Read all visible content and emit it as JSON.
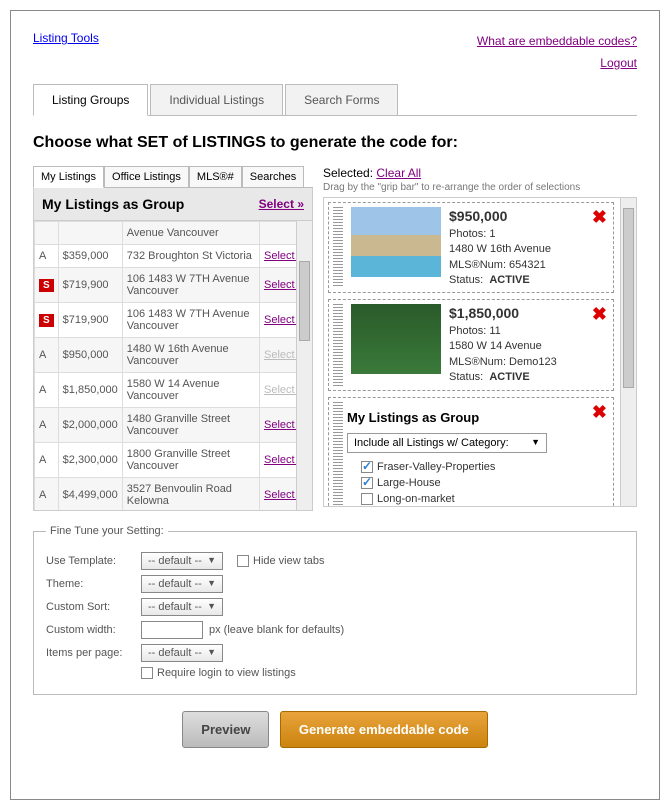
{
  "top": {
    "listing_tools": "Listing Tools",
    "what_are": "What are embeddable codes?",
    "logout": "Logout"
  },
  "main_tabs": [
    "Listing Groups",
    "Individual Listings",
    "Search Forms"
  ],
  "heading": "Choose what SET of LISTINGS to generate the code for:",
  "sub_tabs": [
    "My Listings",
    "Office Listings",
    "MLS®#",
    "Searches"
  ],
  "group_title": "My Listings as Group",
  "select_all": "Select »",
  "listings": [
    {
      "st": "",
      "price": "",
      "addr": "Avenue Vancouver",
      "sel": "",
      "muted": false
    },
    {
      "st": "A",
      "price": "$359,000",
      "addr": "732 Broughton St Victoria",
      "sel": "Select »",
      "muted": false
    },
    {
      "st": "S",
      "price": "$719,900",
      "addr": "106 1483 W 7TH Avenue Vancouver",
      "sel": "Select »",
      "muted": false,
      "badge": true
    },
    {
      "st": "S",
      "price": "$719,900",
      "addr": "106 1483 W 7TH Avenue Vancouver",
      "sel": "Select »",
      "muted": false,
      "badge": true
    },
    {
      "st": "A",
      "price": "$950,000",
      "addr": "1480 W 16th Avenue Vancouver",
      "sel": "Select »",
      "muted": true
    },
    {
      "st": "A",
      "price": "$1,850,000",
      "addr": "1580 W 14 Avenue Vancouver",
      "sel": "Select »",
      "muted": true
    },
    {
      "st": "A",
      "price": "$2,000,000",
      "addr": "1480 Granville Street Vancouver",
      "sel": "Select »",
      "muted": false
    },
    {
      "st": "A",
      "price": "$2,300,000",
      "addr": "1800 Granville Street Vancouver",
      "sel": "Select »",
      "muted": false
    },
    {
      "st": "A",
      "price": "$4,499,000",
      "addr": "3527 Benvoulin Road Kelowna",
      "sel": "Select »",
      "muted": false
    }
  ],
  "selected_label": "Selected:",
  "clear_all": "Clear All",
  "drag_hint": "Drag by the \"grip bar\" to re-arrange the order of selections",
  "cards": [
    {
      "price": "$950,000",
      "photos": "Photos: 1",
      "addr": "1480 W 16th Avenue",
      "mls": "MLS®Num: 654321",
      "status_lbl": "Status:",
      "status": "ACTIVE",
      "cls": "villa"
    },
    {
      "price": "$1,850,000",
      "photos": "Photos: 11",
      "addr": "1580 W 14 Avenue",
      "mls": "MLS®Num: Demo123",
      "status_lbl": "Status:",
      "status": "ACTIVE",
      "cls": "ivy"
    }
  ],
  "group_card": {
    "title": "My Listings as Group",
    "cat_label": "Include all Listings w/ Category:",
    "cats": [
      {
        "label": "Fraser-Valley-Properties",
        "on": true
      },
      {
        "label": "Large-House",
        "on": true
      },
      {
        "label": "Long-on-market",
        "on": false
      }
    ]
  },
  "fieldset": {
    "legend": "Fine Tune your Setting:",
    "use_template": "Use Template:",
    "theme": "Theme:",
    "custom_sort": "Custom Sort:",
    "custom_width": "Custom width:",
    "items_pp": "Items per page:",
    "default": "-- default --",
    "hide_tabs": "Hide view tabs",
    "px_hint": "px (leave blank for defaults)",
    "require_login": "Require login to view listings"
  },
  "buttons": {
    "preview": "Preview",
    "generate": "Generate embeddable code"
  }
}
